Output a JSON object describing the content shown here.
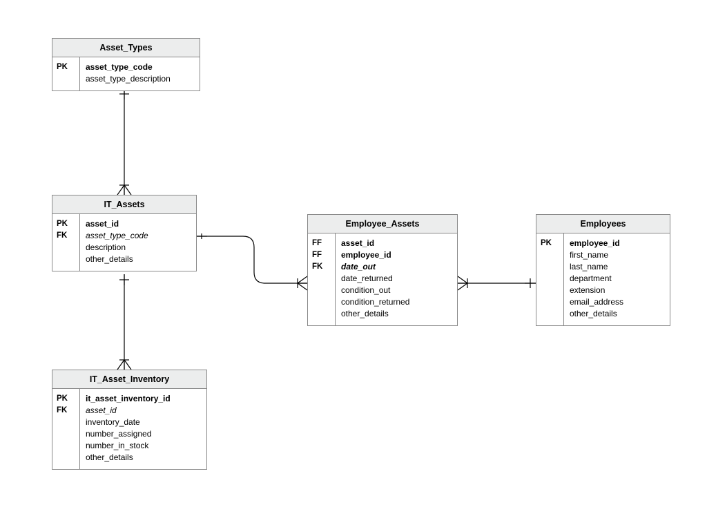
{
  "entities": {
    "asset_types": {
      "title": "Asset_Types",
      "keys": [
        "PK",
        ""
      ],
      "fields": [
        {
          "name": "asset_type_code",
          "class": "pkfield"
        },
        {
          "name": "asset_type_description",
          "class": ""
        }
      ]
    },
    "it_assets": {
      "title": "IT_Assets",
      "keys": [
        "PK",
        "FK",
        "",
        ""
      ],
      "fields": [
        {
          "name": "asset_id",
          "class": "pkfield"
        },
        {
          "name": "asset_type_code",
          "class": "fkfield"
        },
        {
          "name": "description",
          "class": ""
        },
        {
          "name": "other_details",
          "class": ""
        }
      ]
    },
    "it_asset_inventory": {
      "title": "IT_Asset_Inventory",
      "keys": [
        "PK",
        "FK",
        "",
        "",
        "",
        ""
      ],
      "fields": [
        {
          "name": "it_asset_inventory_id",
          "class": "pkfield"
        },
        {
          "name": "asset_id",
          "class": "fkfield"
        },
        {
          "name": "inventory_date",
          "class": ""
        },
        {
          "name": "number_assigned",
          "class": ""
        },
        {
          "name": "number_in_stock",
          "class": ""
        },
        {
          "name": "other_details",
          "class": ""
        }
      ]
    },
    "employee_assets": {
      "title": "Employee_Assets",
      "keys": [
        "FF",
        "FF",
        "FK",
        "",
        "",
        "",
        ""
      ],
      "fields": [
        {
          "name": "asset_id",
          "class": "pkfield"
        },
        {
          "name": "employee_id",
          "class": "pkfield"
        },
        {
          "name": "date_out",
          "class": "pkfkfield"
        },
        {
          "name": "date_returned",
          "class": ""
        },
        {
          "name": "condition_out",
          "class": ""
        },
        {
          "name": "condition_returned",
          "class": ""
        },
        {
          "name": "other_details",
          "class": ""
        }
      ]
    },
    "employees": {
      "title": "Employees",
      "keys": [
        "PK",
        "",
        "",
        "",
        "",
        "",
        ""
      ],
      "fields": [
        {
          "name": "employee_id",
          "class": "pkfield"
        },
        {
          "name": "first_name",
          "class": ""
        },
        {
          "name": "last_name",
          "class": ""
        },
        {
          "name": "department",
          "class": ""
        },
        {
          "name": "extension",
          "class": ""
        },
        {
          "name": "email_address",
          "class": ""
        },
        {
          "name": "other_details",
          "class": ""
        }
      ]
    }
  }
}
